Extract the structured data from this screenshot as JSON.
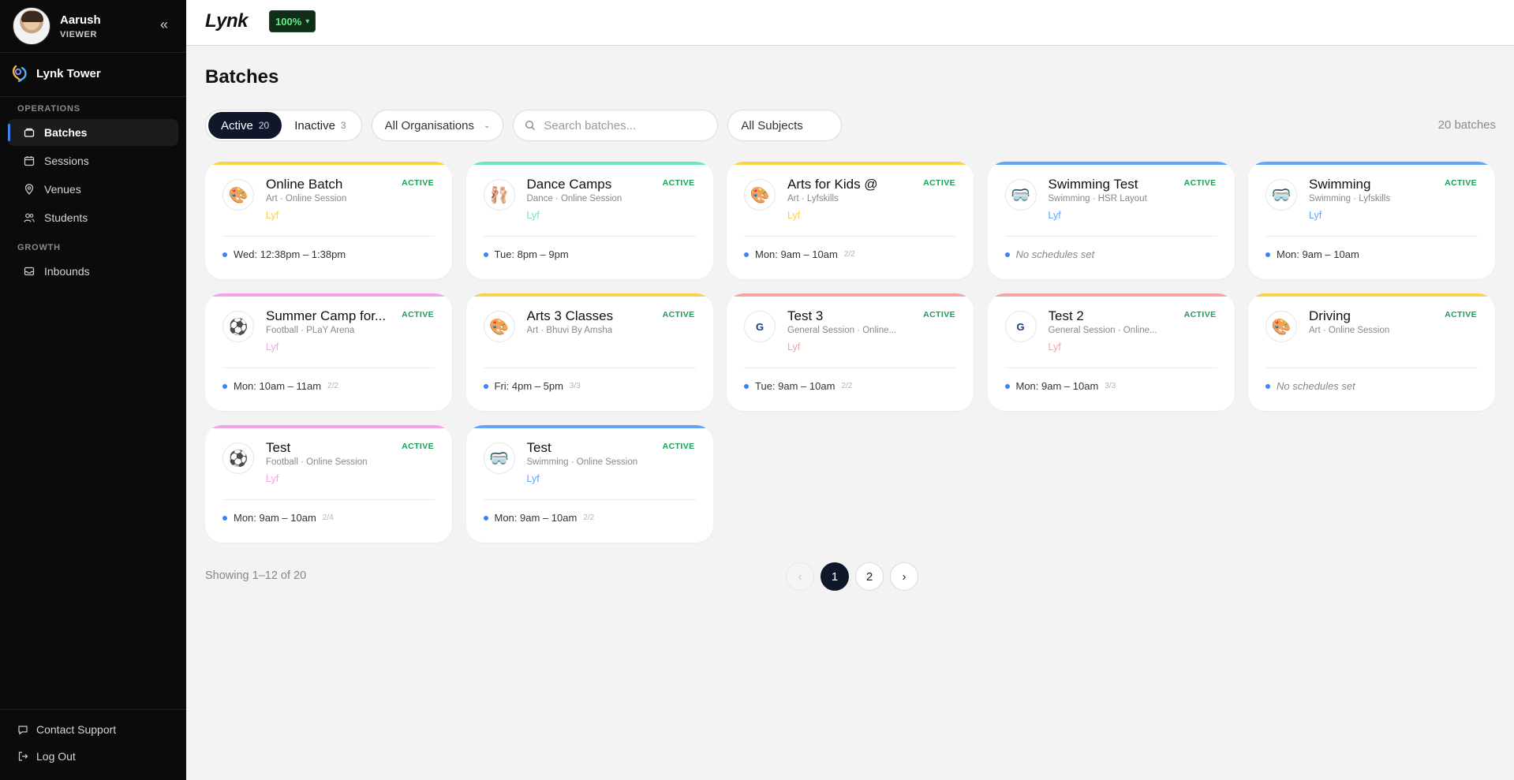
{
  "sidebar": {
    "user_name": "Aarush",
    "user_role": "VIEWER",
    "collapse_icon": "«",
    "org_name": "Lynk Tower",
    "section_operations": "OPERATIONS",
    "section_growth": "GROWTH",
    "nav": [
      {
        "label": "Batches",
        "icon": "batches-icon",
        "active": true
      },
      {
        "label": "Sessions",
        "icon": "calendar-icon"
      },
      {
        "label": "Venues",
        "icon": "location-pin-icon"
      },
      {
        "label": "Students",
        "icon": "users-icon"
      }
    ],
    "growth_nav": [
      {
        "label": "Inbounds",
        "icon": "inbox-icon"
      }
    ],
    "footer": [
      {
        "label": "Contact Support",
        "icon": "chat-icon"
      },
      {
        "label": "Log Out",
        "icon": "logout-icon"
      }
    ]
  },
  "topbar": {
    "logo": "Lynk",
    "zoom": "100%"
  },
  "main": {
    "title": "Batches",
    "tabs": [
      {
        "label": "Active",
        "count": "20",
        "selected": true
      },
      {
        "label": "Inactive",
        "count": "3",
        "selected": false
      }
    ],
    "org_filter": "All Organisations",
    "search_placeholder": "Search batches...",
    "subject_filter": "All Subjects",
    "batch_count": "20 batches",
    "showing": "Showing 1–12 of 20",
    "pagination": {
      "prev": "‹",
      "pages": [
        "1",
        "2"
      ],
      "current": "1",
      "next": "›"
    }
  },
  "colors": {
    "art": "#f8d24a",
    "dance": "#6ee7b7",
    "swimming": "#60a5fa",
    "football": "#f5a3e6",
    "general": "#f6a3a3",
    "status_active": "#18a058"
  },
  "cards": [
    {
      "title": "Online Batch",
      "meta": "Art · Online Session",
      "org": "Lyf",
      "status": "ACTIVE",
      "icon": "palette-icon",
      "glyph": "🎨",
      "accent": "#f8d24a",
      "schedule": "Wed: 12:38pm – 1:38pm",
      "fraction": ""
    },
    {
      "title": "Dance Camps",
      "meta": "Dance · Online Session",
      "org": "Lyf",
      "status": "ACTIVE",
      "icon": "dance-shoes-icon",
      "glyph": "🩰",
      "accent": "#6ee7b7",
      "schedule": "Tue: 8pm – 9pm",
      "fraction": ""
    },
    {
      "title": "Arts for Kids @",
      "meta": "Art · Lyfskills",
      "org": "Lyf",
      "status": "ACTIVE",
      "icon": "palette-icon",
      "glyph": "🎨",
      "accent": "#f8d24a",
      "schedule": "Mon: 9am – 10am",
      "fraction": "2/2"
    },
    {
      "title": "Swimming Test",
      "meta": "Swimming · HSR Layout",
      "org": "Lyf",
      "status": "ACTIVE",
      "icon": "goggles-icon",
      "glyph": "🥽",
      "accent": "#60a5fa",
      "schedule": "No schedules set",
      "fraction": "",
      "none": true
    },
    {
      "title": "Swimming",
      "meta": "Swimming · Lyfskills",
      "org": "Lyf",
      "status": "ACTIVE",
      "icon": "goggles-icon",
      "glyph": "🥽",
      "accent": "#60a5fa",
      "schedule": "Mon: 9am – 10am",
      "fraction": ""
    },
    {
      "title": "Summer Camp for...",
      "meta": "Football · PLaY Arena",
      "org": "Lyf",
      "status": "ACTIVE",
      "icon": "football-icon",
      "glyph": "⚽",
      "accent": "#f5a3e6",
      "schedule": "Mon: 10am – 11am",
      "fraction": "2/2"
    },
    {
      "title": "Arts 3 Classes",
      "meta": "Art · Bhuvi By Amsha",
      "org": "",
      "status": "ACTIVE",
      "icon": "palette-icon",
      "glyph": "🎨",
      "accent": "#f8d24a",
      "schedule": "Fri: 4pm – 5pm",
      "fraction": "3/3"
    },
    {
      "title": "Test 3",
      "meta": "General Session · Online...",
      "org": "Lyf",
      "status": "ACTIVE",
      "icon": "general-letter-icon",
      "glyph": "G",
      "accent": "#f6a3a3",
      "schedule": "Tue: 9am – 10am",
      "fraction": "2/2",
      "letter": true
    },
    {
      "title": "Test 2",
      "meta": "General Session · Online...",
      "org": "Lyf",
      "status": "ACTIVE",
      "icon": "general-letter-icon",
      "glyph": "G",
      "accent": "#f6a3a3",
      "schedule": "Mon: 9am – 10am",
      "fraction": "3/3",
      "letter": true
    },
    {
      "title": "Driving",
      "meta": "Art · Online Session",
      "org": "",
      "status": "ACTIVE",
      "icon": "palette-icon",
      "glyph": "🎨",
      "accent": "#f8d24a",
      "schedule": "No schedules set",
      "fraction": "",
      "none": true
    },
    {
      "title": "Test",
      "meta": "Football · Online Session",
      "org": "Lyf",
      "status": "ACTIVE",
      "icon": "football-icon",
      "glyph": "⚽",
      "accent": "#f5a3e6",
      "schedule": "Mon: 9am – 10am",
      "fraction": "2/4"
    },
    {
      "title": "Test",
      "meta": "Swimming · Online Session",
      "org": "Lyf",
      "status": "ACTIVE",
      "icon": "goggles-icon",
      "glyph": "🥽",
      "accent": "#60a5fa",
      "schedule": "Mon: 9am – 10am",
      "fraction": "2/2"
    }
  ]
}
